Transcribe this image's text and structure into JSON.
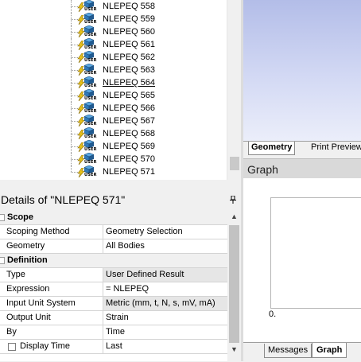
{
  "tree": {
    "items": [
      {
        "label": "NLEPEQ 558",
        "selected": false
      },
      {
        "label": "NLEPEQ 559",
        "selected": false
      },
      {
        "label": "NLEPEQ 560",
        "selected": false
      },
      {
        "label": "NLEPEQ 561",
        "selected": false
      },
      {
        "label": "NLEPEQ 562",
        "selected": false
      },
      {
        "label": "NLEPEQ 563",
        "selected": false
      },
      {
        "label": "NLEPEQ 564",
        "selected": true
      },
      {
        "label": "NLEPEQ 565",
        "selected": false
      },
      {
        "label": "NLEPEQ 566",
        "selected": false
      },
      {
        "label": "NLEPEQ 567",
        "selected": false
      },
      {
        "label": "NLEPEQ 568",
        "selected": false
      },
      {
        "label": "NLEPEQ 569",
        "selected": false
      },
      {
        "label": "NLEPEQ 570",
        "selected": false
      },
      {
        "label": "NLEPEQ 571",
        "selected": false
      }
    ],
    "icon_badge": "USER",
    "icon": "user-defined-result-icon"
  },
  "geometry_view": {
    "tabs": [
      "Geometry",
      "Print Preview"
    ]
  },
  "graph": {
    "title": "Graph",
    "axis_origin_label": "0.",
    "tabs": [
      "Messages",
      "Graph"
    ]
  },
  "details": {
    "title": "Details of \"NLEPEQ 571\"",
    "pin_icon": "pin-icon",
    "groups": {
      "scope": "Scope",
      "definition": "Definition"
    },
    "rows": {
      "scoping_method": {
        "label": "Scoping Method",
        "value": "Geometry Selection"
      },
      "geometry": {
        "label": "Geometry",
        "value": "All Bodies"
      },
      "type": {
        "label": "Type",
        "value": "User Defined Result"
      },
      "expression": {
        "label": "Expression",
        "value": "= NLEPEQ"
      },
      "input_unit_system": {
        "label": "Input Unit System",
        "value": "Metric (mm, t, N, s, mV, mA)"
      },
      "output_unit": {
        "label": "Output Unit",
        "value": "Strain"
      },
      "by": {
        "label": "By",
        "value": "Time"
      },
      "display_time": {
        "label": "Display Time",
        "value": "Last"
      }
    }
  },
  "colors": {
    "viewport_top": "#b3bde8",
    "viewport_bottom": "#ebeefa",
    "readonly_cell": "#e6e6e6"
  }
}
